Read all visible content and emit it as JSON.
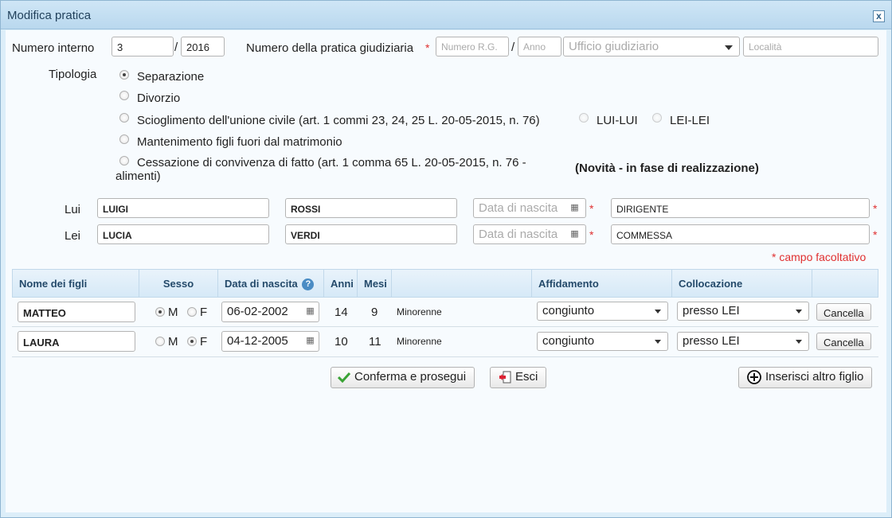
{
  "window": {
    "title": "Modifica pratica",
    "close": "x"
  },
  "header": {
    "numero_interno_label": "Numero interno",
    "numero_interno": "3",
    "separator": "/",
    "anno_interno": "2016",
    "pratica_label": "Numero della pratica giudiziaria",
    "required_mark": "*",
    "numero_rg_placeholder": "Numero R.G.",
    "anno_placeholder": "Anno",
    "ufficio_placeholder": "Ufficio giudiziario",
    "localita_placeholder": "Località"
  },
  "tipologia": {
    "label": "Tipologia",
    "options": [
      {
        "label": "Separazione",
        "selected": true
      },
      {
        "label": "Divorzio",
        "selected": false
      },
      {
        "label": "Scioglimento dell'unione civile (art. 1 commi 23, 24, 25 L. 20-05-2015, n. 76)",
        "selected": false
      },
      {
        "label": "Mantenimento figli fuori dal matrimonio",
        "selected": false
      },
      {
        "label": "Cessazione di convivenza di fatto (art. 1 comma 65 L. 20-05-2015, n. 76 -",
        "label2": "alimenti)",
        "selected": false
      }
    ],
    "sub_options": [
      "LUI-LUI",
      "LEI-LEI"
    ],
    "novita": "(Novità - in fase di realizzazione)"
  },
  "persone": {
    "lui": {
      "label": "Lui",
      "nome": "LUIGI",
      "cognome": "ROSSI",
      "data_placeholder": "Data di nascita",
      "professione": "DIRIGENTE"
    },
    "lei": {
      "label": "Lei",
      "nome": "LUCIA",
      "cognome": "VERDI",
      "data_placeholder": "Data di nascita",
      "professione": "COMMESSA"
    },
    "facoltativo_note": "* campo facoltativo"
  },
  "figli": {
    "columns": [
      "Nome dei figli",
      "Sesso",
      "Data di nascita",
      "Anni",
      "Mesi",
      "",
      "Affidamento",
      "Collocazione",
      ""
    ],
    "rows": [
      {
        "nome": "MATTEO",
        "sesso": "M",
        "data": "06-02-2002",
        "anni": "14",
        "mesi": "9",
        "stato": "Minorenne",
        "affidamento": "congiunto",
        "collocazione": "presso LEI",
        "cancella": "Cancella"
      },
      {
        "nome": "LAURA",
        "sesso": "F",
        "data": "04-12-2005",
        "anni": "10",
        "mesi": "11",
        "stato": "Minorenne",
        "affidamento": "congiunto",
        "collocazione": "presso LEI",
        "cancella": "Cancella"
      }
    ],
    "sex_m": "M",
    "sex_f": "F"
  },
  "actions": {
    "conferma": "Conferma e prosegui",
    "esci": "Esci",
    "inserisci": "Inserisci altro figlio"
  },
  "colors": {
    "accent": "#244a6a",
    "required": "#e03030",
    "check_green": "#3aa335"
  },
  "icons": [
    "close-icon",
    "calendar-icon",
    "help-icon",
    "dropdown-caret-icon",
    "check-icon",
    "exit-icon",
    "add-circle-icon"
  ]
}
